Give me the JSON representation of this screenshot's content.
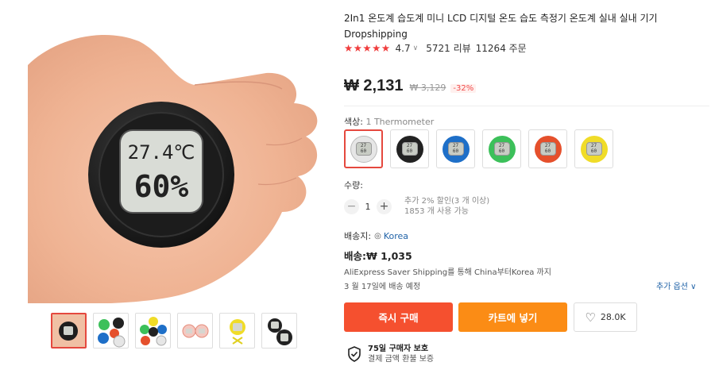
{
  "product": {
    "title": "2In1 온도계 습도계 미니 LCD 디지털 온도 습도 측정기 온도계 실내 실내 기기 Dropshipping",
    "rating": "4.7",
    "reviews": "5721 리뷰",
    "orders": "11264 주문"
  },
  "price": {
    "current": "₩ 2,131",
    "original": "₩ 3,129",
    "discount": "-32%"
  },
  "display": {
    "temp": "27.4℃",
    "humidity": "60%"
  },
  "color": {
    "label": "색상:",
    "selected": "1 Thermometer",
    "options": [
      {
        "ring": "#e6e6e6"
      },
      {
        "ring": "#222222"
      },
      {
        "ring": "#1e6fc8"
      },
      {
        "ring": "#3cc05a"
      },
      {
        "ring": "#e5502c"
      },
      {
        "ring": "#f0dc28"
      }
    ]
  },
  "quantity": {
    "label": "수량:",
    "value": "1",
    "minus": "−",
    "plus": "+",
    "note1": "추가 2% 할인(3 개 이상)",
    "note2": "1853 개 사용 가능"
  },
  "shipping": {
    "to_label": "배송지:",
    "country": "Korea",
    "cost": "배송:₩ 1,035",
    "via": "AliExpress Saver Shipping를 통해 China부터Korea 까지",
    "date": "3 월 17일에 배송 예정",
    "more": "추가 옵션 ∨"
  },
  "actions": {
    "buy": "즉시 구매",
    "cart": "카트에 넣기",
    "wishlist": "28.0K"
  },
  "protection": {
    "title": "75일 구매자 보호",
    "subtitle": "결제 금액 환불 보증"
  },
  "icons": {
    "star": "star-icon",
    "pin": "location-pin-icon",
    "heart": "heart-icon",
    "shield": "shield-icon"
  },
  "colors": {
    "buy": "#f5502f",
    "cart": "#fb8c15",
    "star": "#f03c3c",
    "accent_link": "#2264a8"
  }
}
